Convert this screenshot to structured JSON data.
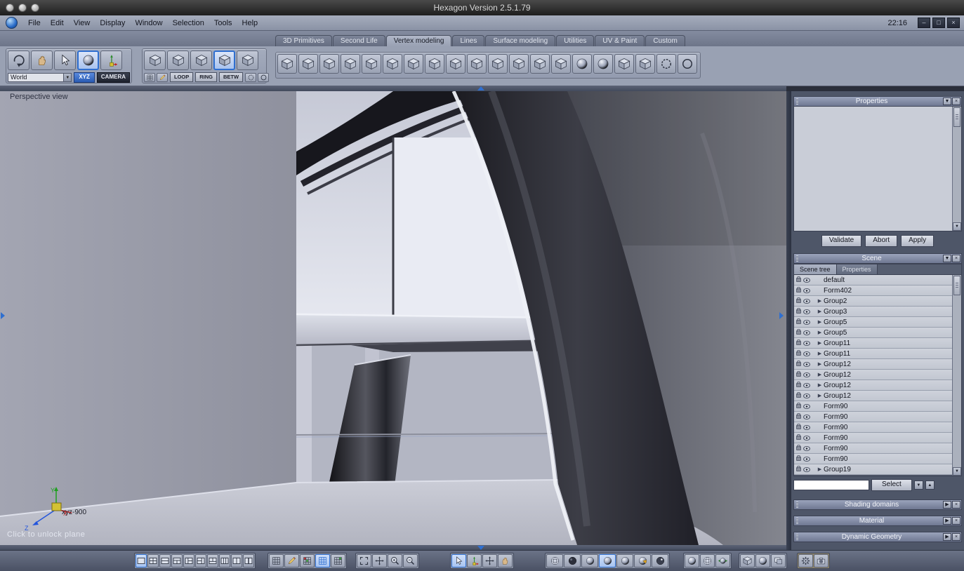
{
  "colors": {
    "accent_blue": "#2f6fd0",
    "toolbar_bg": "#99a1b3",
    "panel_header_bg": "#7d87a1",
    "viewport_dark_band": "#26262c",
    "xyz_button_bg": "#3a6fc4"
  },
  "glyph_chars": {
    "down": "▼",
    "up": "▲",
    "right": "▶",
    "close": "×",
    "minimize": "–",
    "maximize": "□"
  },
  "window": {
    "title": "Hexagon Version 2.5.1.79",
    "clock": "22:16"
  },
  "menubar": {
    "items": [
      "File",
      "Edit",
      "View",
      "Display",
      "Window",
      "Selection",
      "Tools",
      "Help"
    ]
  },
  "tabs": [
    {
      "id": "tab-3d-primitives",
      "label": "3D Primitives",
      "active": false
    },
    {
      "id": "tab-second-life",
      "label": "Second Life",
      "active": false
    },
    {
      "id": "tab-vertex-modeling",
      "label": "Vertex modeling",
      "active": true
    },
    {
      "id": "tab-lines",
      "label": "Lines",
      "active": false
    },
    {
      "id": "tab-surface-modeling",
      "label": "Surface modeling",
      "active": false
    },
    {
      "id": "tab-utilities",
      "label": "Utilities",
      "active": false
    },
    {
      "id": "tab-uv-paint",
      "label": "UV & Paint",
      "active": false
    },
    {
      "id": "tab-custom",
      "label": "Custom",
      "active": false
    }
  ],
  "toolbar": {
    "world_select": {
      "value": "World"
    },
    "xyz_button": "XYZ",
    "camera_button": "CAMERA",
    "loop_button": "LOOP",
    "ring_button": "RING",
    "betw_button": "BETW",
    "nav_tools": [
      {
        "name": "orbit-camera-icon",
        "glyph": "orbit",
        "active": false
      },
      {
        "name": "pan-camera-icon",
        "glyph": "hand",
        "active": false
      },
      {
        "name": "cursor-tool-icon",
        "glyph": "cursor",
        "active": false
      },
      {
        "name": "sphere-view-icon",
        "glyph": "sphere",
        "active": true
      },
      {
        "name": "manipulator-tool-icon",
        "glyph": "axes",
        "active": false
      }
    ],
    "selection_modes": [
      {
        "name": "select-points-icon",
        "glyph": "cube",
        "active": false
      },
      {
        "name": "select-edges-icon",
        "glyph": "cube",
        "active": false
      },
      {
        "name": "select-faces-icon",
        "glyph": "cube",
        "active": false
      },
      {
        "name": "select-objects-icon",
        "glyph": "cube",
        "active": true
      },
      {
        "name": "select-multi-icon",
        "glyph": "cube",
        "active": false
      }
    ],
    "select_extras_left": [
      {
        "name": "area-select-icon",
        "glyph": "grid"
      },
      {
        "name": "paint-select-icon",
        "glyph": "pencil"
      }
    ],
    "select_extras_right": [
      {
        "name": "grow-selection-icon",
        "glyph": "circleDash"
      },
      {
        "name": "ring-selection-icon",
        "glyph": "circle"
      }
    ],
    "modeling_tools": [
      {
        "name": "smoothing-tool-icon",
        "glyph": "cube"
      },
      {
        "name": "stretch-tool-icon",
        "glyph": "cube"
      },
      {
        "name": "copy-tool-icon",
        "glyph": "cube"
      },
      {
        "name": "extract-around-tool-icon",
        "glyph": "cube"
      },
      {
        "name": "extract-along-tool-icon",
        "glyph": "cube"
      },
      {
        "name": "fast-extrude-tool-icon",
        "glyph": "cube"
      },
      {
        "name": "sweep-surface-tool-icon",
        "glyph": "cube"
      },
      {
        "name": "weld-points-tool-icon",
        "glyph": "cube"
      },
      {
        "name": "average-weld-tool-icon",
        "glyph": "cube"
      },
      {
        "name": "target-weld-tool-icon",
        "glyph": "cube"
      },
      {
        "name": "bridge-tool-icon",
        "glyph": "cube"
      },
      {
        "name": "tunnel-tool-icon",
        "glyph": "cube"
      },
      {
        "name": "close-surface-tool-icon",
        "glyph": "cube"
      },
      {
        "name": "dissolve-tool-icon",
        "glyph": "cube"
      },
      {
        "name": "decimate-tool-icon",
        "glyph": "sphere"
      },
      {
        "name": "triangulate-tool-icon",
        "glyph": "sphere"
      },
      {
        "name": "quadrangulate-tool-icon",
        "glyph": "cube"
      },
      {
        "name": "connect-edges-tool-icon",
        "glyph": "cube"
      },
      {
        "name": "symmetry-tool-icon",
        "glyph": "circleDash"
      },
      {
        "name": "magnet-tool-icon",
        "glyph": "circle"
      }
    ]
  },
  "viewport": {
    "label": "Perspective view",
    "hint": "Click to unlock plane",
    "gizmo": {
      "axis_x": "X",
      "axis_y": "Y",
      "axis_z": "Z",
      "label": "xyz-900"
    }
  },
  "properties_panel": {
    "title": "Properties",
    "validate_button": "Validate",
    "abort_button": "Abort",
    "apply_button": "Apply"
  },
  "scene_panel": {
    "title": "Scene",
    "tabs": [
      {
        "id": "tab-scene-tree",
        "label": "Scene tree",
        "active": true
      },
      {
        "id": "tab-scene-properties",
        "label": "Properties",
        "active": false
      }
    ],
    "tree": [
      {
        "label": "default",
        "expandable": false
      },
      {
        "label": "Form402",
        "expandable": false
      },
      {
        "label": "Group2",
        "expandable": true
      },
      {
        "label": "Group3",
        "expandable": true
      },
      {
        "label": "Group5",
        "expandable": true
      },
      {
        "label": "Group5",
        "expandable": true
      },
      {
        "label": "Group11",
        "expandable": true
      },
      {
        "label": "Group11",
        "expandable": true
      },
      {
        "label": "Group12",
        "expandable": true
      },
      {
        "label": "Group12",
        "expandable": true
      },
      {
        "label": "Group12",
        "expandable": true
      },
      {
        "label": "Group12",
        "expandable": true
      },
      {
        "label": "Form90",
        "expandable": false
      },
      {
        "label": "Form90",
        "expandable": false
      },
      {
        "label": "Form90",
        "expandable": false
      },
      {
        "label": "Form90",
        "expandable": false
      },
      {
        "label": "Form90",
        "expandable": false
      },
      {
        "label": "Form90",
        "expandable": false
      },
      {
        "label": "Group19",
        "expandable": true
      }
    ],
    "filter_input_value": "",
    "select_button": "Select"
  },
  "panels_collapsed": [
    {
      "id": "shading-domains",
      "title": "Shading domains"
    },
    {
      "id": "material",
      "title": "Material"
    },
    {
      "id": "dynamic-geometry",
      "title": "Dynamic Geometry"
    }
  ],
  "bottom_toolbar": {
    "layout_icons": [
      {
        "name": "layout-single-icon",
        "glyph": "lay1",
        "active": true
      },
      {
        "name": "layout-four-views-icon",
        "glyph": "lay4",
        "active": false
      },
      {
        "name": "layout-two-rows-icon",
        "glyph": "lay2h",
        "active": false
      },
      {
        "name": "layout-top-split-icon",
        "glyph": "layT",
        "active": false
      },
      {
        "name": "layout-left-split-icon",
        "glyph": "layL",
        "active": false
      },
      {
        "name": "layout-right-split-icon",
        "glyph": "layR",
        "active": false
      },
      {
        "name": "layout-bottom-split-icon",
        "glyph": "layB",
        "active": false
      },
      {
        "name": "layout-three-columns-icon",
        "glyph": "lay3v",
        "active": false
      },
      {
        "name": "layout-two-columns-icon",
        "glyph": "lay2v",
        "active": false
      },
      {
        "name": "layout-two-panes-icon",
        "glyph": "lay2n",
        "active": false
      }
    ],
    "grid_icons": [
      {
        "name": "grid-display-icon",
        "glyph": "grid",
        "active": false
      },
      {
        "name": "axis-display-icon",
        "glyph": "pencil",
        "active": false
      },
      {
        "name": "snap-grid-icon",
        "glyph": "gridColor",
        "active": false
      },
      {
        "name": "snap-lines-icon",
        "glyph": "gridBlue",
        "active": true
      },
      {
        "name": "snap-points-icon",
        "glyph": "gridGreen",
        "active": false
      }
    ],
    "view_icons": [
      {
        "name": "fit-view-icon",
        "glyph": "expand",
        "active": false
      },
      {
        "name": "center-selection-icon",
        "glyph": "move",
        "active": false
      },
      {
        "name": "zoom-in-icon",
        "glyph": "zoomin",
        "active": false
      },
      {
        "name": "zoom-out-icon",
        "glyph": "zoomout",
        "active": false
      }
    ],
    "cursor_icons": [
      {
        "name": "select-cursor-icon",
        "glyph": "cursor",
        "active": true
      },
      {
        "name": "rotate-manipulator-icon",
        "glyph": "axes",
        "active": false
      },
      {
        "name": "move-manipulator-icon",
        "glyph": "move",
        "active": false
      },
      {
        "name": "hand-tool-icon",
        "glyph": "hand",
        "active": false
      }
    ],
    "shading_icons": [
      {
        "name": "wireframe-shading-icon",
        "glyph": "sphereWire",
        "active": false
      },
      {
        "name": "hidden-line-shading-icon",
        "glyph": "sphereDark",
        "active": false
      },
      {
        "name": "flat-shading-icon",
        "glyph": "sphere",
        "active": false
      },
      {
        "name": "smooth-shading-icon",
        "glyph": "sphere",
        "active": true
      },
      {
        "name": "textured-shading-icon",
        "glyph": "sphere",
        "active": false
      },
      {
        "name": "material-shading-icon",
        "glyph": "sphereSeg",
        "active": false
      },
      {
        "name": "point-shading-icon",
        "glyph": "sphereDot",
        "active": false
      }
    ],
    "subdivision_icons": [
      {
        "name": "low-poly-preview-icon",
        "glyph": "sphere",
        "active": false
      },
      {
        "name": "smoothed-preview-icon",
        "glyph": "sphereWire",
        "active": false
      },
      {
        "name": "dynamic-subdivision-icon",
        "glyph": "sphereArrows",
        "active": false
      }
    ],
    "display_panel_icons": [
      {
        "name": "object-display-icon",
        "glyph": "cube",
        "active": false
      },
      {
        "name": "material-display-icon",
        "glyph": "sphere",
        "active": false
      },
      {
        "name": "panel-toggle-icon",
        "glyph": "panel",
        "active": false
      }
    ],
    "render_icons": [
      {
        "name": "render-settings-icon",
        "glyph": "gear",
        "active": false
      },
      {
        "name": "render-camera-icon",
        "glyph": "camera",
        "active": false
      }
    ]
  }
}
